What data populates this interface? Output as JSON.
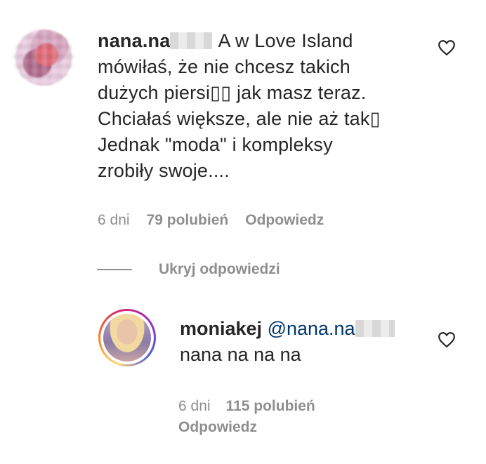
{
  "comment": {
    "username": "nana.na",
    "text_lines": [
      "A w Love Island",
      "mówiłaś, że nie chcesz takich",
      "dużych piersi▯▯ jak masz teraz.",
      "Chciałaś większe, ale nie aż tak▯",
      "Jednak \"moda\" i kompleksy",
      "zrobiły swoje...."
    ],
    "time": "6 dni",
    "likes": "79 polubień",
    "reply_label": "Odpowiedz"
  },
  "replies_toggle": {
    "label": "Ukryj odpowiedzi"
  },
  "reply": {
    "username": "moniakej",
    "mention": "@nana.na",
    "text": "nana na na na",
    "time": "6 dni",
    "likes": "115 polubień",
    "reply_label": "Odpowiedz"
  },
  "icons": {
    "like": "heart-outline-icon"
  },
  "colors": {
    "text": "#262626",
    "muted": "#8e8e8e",
    "mention": "#00376b"
  }
}
